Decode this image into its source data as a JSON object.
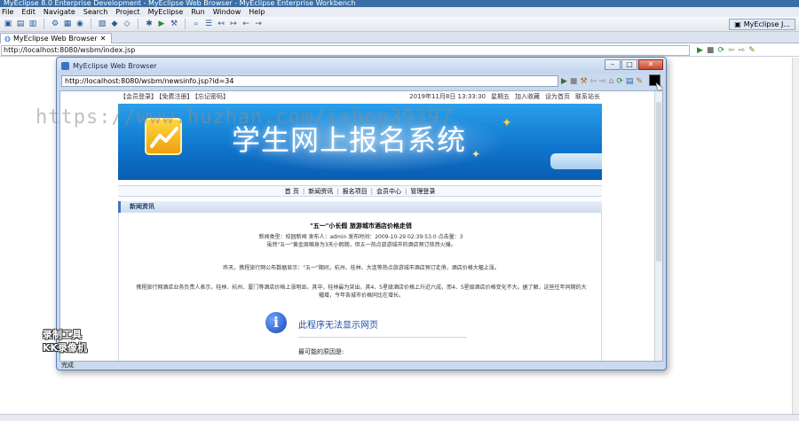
{
  "ide": {
    "title": "MyEclipse 8.0 Enterprise Development - MyEclipse Web Browser - MyEclipse Enterprise Workbench",
    "menu": [
      "File",
      "Edit",
      "Navigate",
      "Search",
      "Project",
      "MyEclipse",
      "Run",
      "Window",
      "Help"
    ],
    "perspective_label": "MyEclipse J...",
    "editor_tab": "MyEclipse Web Browser",
    "url": "http://localhost:8080/wsbm/index.jsp"
  },
  "dialog": {
    "title": "MyEclipse Web Browser",
    "url": "http://localhost:8080/wsbm/newsinfo.jsp?id=34",
    "status": "完成"
  },
  "page": {
    "top_links": [
      "【会员登录】",
      "【免费注册】",
      "【忘记密码】"
    ],
    "datetime": "2019年11月8日 13:33:30",
    "weekday": "星期五",
    "top_actions": [
      "加入收藏",
      "设为首页",
      "联系站长"
    ],
    "banner_title": "学生网上报名系统",
    "nav": [
      "首 页",
      "新闻资讯",
      "报名项目",
      "会员中心",
      "管理登录"
    ],
    "section_title": "新闻资讯",
    "article": {
      "title": "\"五一\"小长假 旅游城市酒店价格走俏",
      "meta": "新闻类型：校园新闻 发布人：admin 发布时间：2009-10-29 02:39:53.0 点击量：3",
      "p1": "虽然\"五一\"黄金周缩身为3天小假期，但五一热点旅游城市的酒店预订依然火爆。",
      "p2": "昨天，携程旅行网公布数据显示：\"五一\"期间，杭州、桂林、大连等热点旅游城市酒店预订走俏，酒店价格大幅上涨。",
      "p3": "携程旅行网酒店业务负责人表示，桂林、杭州、厦门等酒店价格上涨明显。其中，桂林最为突出，其4、5星级酒店价格上升近六成，而4、5星级酒店价格变化不大。据了解，这些往年同期的大幅增，今年各城市价格同比在增长。"
    },
    "error_title": "此程序无法显示网页",
    "error_reason": "最可能的原因是:"
  },
  "overlays": {
    "watermark": "https://www.huzhan.com/ishop39397",
    "recorder_line1": "录制工具",
    "recorder_line2": "KK录像机"
  },
  "colors": {
    "banner_top": "#2aa0ea",
    "banner_bottom": "#0a5cb2",
    "ide_title": "#3a6ea5",
    "error_link": "#1f4fa4"
  }
}
